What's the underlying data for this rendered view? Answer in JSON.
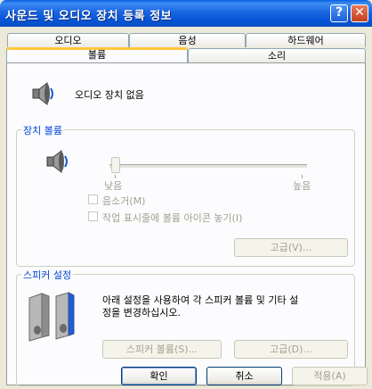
{
  "window": {
    "title": "사운드 및 오디오 장치 등록 정보",
    "help_glyph": "?",
    "close_glyph": "✕"
  },
  "tabs_row1": [
    "오디오",
    "음성",
    "하드웨어"
  ],
  "tabs_row2": [
    "볼륨",
    "소리"
  ],
  "device_status": "오디오 장치 없음",
  "device_volume": {
    "label": "장치 볼륨",
    "slider_low": "낮음",
    "slider_high": "높음",
    "slider_level": 0,
    "mute_label": "음소거(M)",
    "tray_label": "작업 표시줄에 볼륨 아이콘 놓기(I)",
    "advanced_button": "고급(V)..."
  },
  "speaker": {
    "label": "스피커 설정",
    "description_line1": "아래 설정을 사용하여 각 스피커 볼륨 및 기타 설",
    "description_line2": "정을 변경하십시오.",
    "volume_button": "스피커 볼륨(S)...",
    "advanced_button": "고급(D)..."
  },
  "dialog_buttons": {
    "ok": "확인",
    "cancel": "취소",
    "apply": "적용(A)"
  }
}
